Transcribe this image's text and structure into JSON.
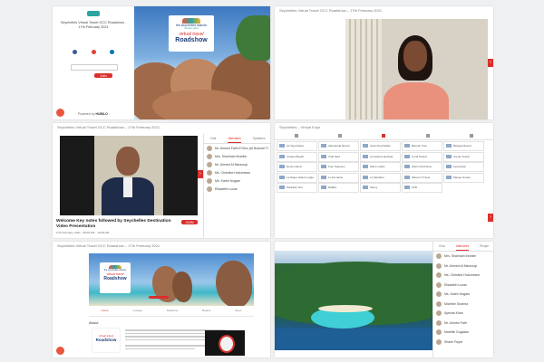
{
  "brand": {
    "title_line1": "the seychelles islands",
    "title_line2": "another world",
    "title_line3": "virtual travel",
    "title_line4": "Roadshow",
    "colors": {
      "accent_red": "#d9302c",
      "deep_blue": "#1d3f7a",
      "teal": "#2aa5a0",
      "sea": "#3fb8c8"
    }
  },
  "panel1": {
    "event_title": "Seychelles Virtual Travel GCC Roadshow -",
    "event_date": "17th February 2021",
    "join_label": "Join",
    "powered_label": "Powered by",
    "hubilo_label": "HUBILO"
  },
  "panel2": {
    "header": "Seychelles Virtual Travel GCC Roadshow – 17th February 2021"
  },
  "panel3": {
    "header": "Seychelles Virtual Travel GCC Roadshow – 17th February 2021",
    "session_title": "Welcome Key notes followed by Seychelles Destination",
    "session_title2": "Video Presentation",
    "session_time": "17th February, 2021 · 09:00 AM – 10:00 AM",
    "join_btn": "JOIN",
    "tabs": [
      "Chat",
      "Attendees",
      "Speakers"
    ],
    "attendees": [
      "Mr. Ahmed Fathi El Bou (Al Bukhari Travel)",
      "Mrs. Shahinah Ibrahim",
      "Mr. Ahmed Al Marzouqi",
      "Ms. Christine Hukumwew",
      "Ms. Karen Nogam",
      "Elisabeth Lucas"
    ]
  },
  "panel4": {
    "header": "Seychelles – Virtual Expo",
    "exhibitors": [
      "Air Seychelles",
      "Allamanda Resort",
      "Avani Seychelles",
      "Banyan Tree",
      "Berjaya Resort",
      "Carana Beach",
      "Club Med",
      "Constance Ephelia",
      "Coral Strand",
      "Creole Travel",
      "Denis Island",
      "Four Seasons",
      "Hilton Labriz",
      "Hilton Northolme",
      "Kempinski",
      "La Digue Island Lodge",
      "Le Domaine",
      "Le Meridien",
      "Mason's Travel",
      "Mango House",
      "Paradise Sun",
      "Raffles",
      "Savoy",
      "STB"
    ]
  },
  "panel5": {
    "header": "Seychelles Virtual Travel GCC Roadshow – 17th February 2021",
    "about_label": "About",
    "nav": [
      "Home",
      "Lounge",
      "Sessions",
      "Rooms",
      "Expo"
    ]
  },
  "panel6": {
    "tabs": [
      "Chat",
      "Attendees",
      "People"
    ],
    "attendees": [
      "Mrs. Shahinah Ibrahim",
      "Mr. Ahmed Al Marzouqi",
      "Ms. Christine Hukumwew",
      "Elisabeth Lucas",
      "Ms. Karen Nogam",
      "Michelle Sharma",
      "Ayesha Khan",
      "Mr. Ahmed Fathi",
      "Marielle Dugasse",
      "Shane Payet"
    ]
  }
}
